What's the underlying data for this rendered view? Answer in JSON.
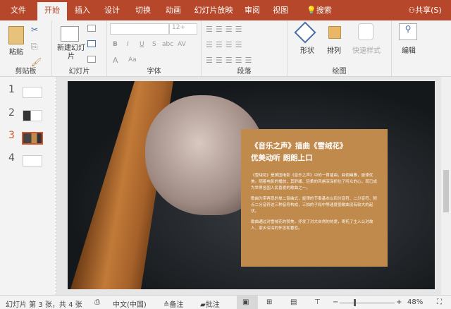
{
  "tabs": [
    "文件",
    "开始",
    "插入",
    "设计",
    "切换",
    "动画",
    "幻灯片放映",
    "审阅",
    "视图",
    "搜索"
  ],
  "share": "共享(S)",
  "ribbon": {
    "clipboard": {
      "label": "剪贴板",
      "paste": "粘贴"
    },
    "slides": {
      "label": "幻灯片",
      "new_slide": "新建幻灯片"
    },
    "font": {
      "label": "字体",
      "size": "12+",
      "bold": "B",
      "italic": "I",
      "underline": "U",
      "strike": "S",
      "abc": "abc",
      "spacing": "AV",
      "fontcolor": "A",
      "aa": "Aa"
    },
    "paragraph": {
      "label": "段落"
    },
    "drawing": {
      "label": "绘图",
      "shapes": "形状",
      "arrange": "排列",
      "quick_styles": "快速样式"
    },
    "editing": {
      "label": "编辑"
    }
  },
  "thumbnails": [
    "1",
    "2",
    "3",
    "4"
  ],
  "selected_slide": 3,
  "card": {
    "title1": "《音乐之声》插曲《雪绒花》",
    "title2": "优美动听 朗朗上口",
    "p1": "《雪绒花》是美国电影《音乐之声》中的一首插曲，曲调幽雅，旋律优美。随着电影的播放，其舒缓、轻柔的风格深深抓住了听众的心，现已成为世界各国人民喜爱的歌曲之一。",
    "p2": "歌曲为带再现的单二部曲式，旋律的节奏基本以四分音符、二分音符、附点二分音符这三种音符构成，三拍的子和中等速度使歌曲没有较大的起伏。",
    "p3": "歌曲通过对雪绒花的赞美，抒发了对大自然的热爱，寄托了主人公对故人、家乡深深的怀念和眷恋。"
  },
  "status": {
    "slide_info": "幻灯片 第 3 张，共 4 张",
    "language": "中文(中国)",
    "notes": "备注",
    "comments": "批注",
    "zoom": "48%",
    "zoom_value": 48
  },
  "colors": {
    "accent": "#b7472a",
    "card": "#c08a4c"
  }
}
